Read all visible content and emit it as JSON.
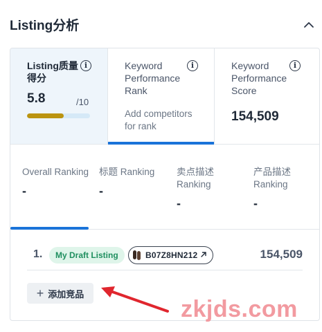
{
  "header": {
    "title": "Listing分析",
    "collapse_icon": "chevron-up-icon"
  },
  "metrics": {
    "score": {
      "label": "Listing质量得分",
      "value": "5.8",
      "max": "/10",
      "fraction": 0.58,
      "bar_color": "#bb9410"
    },
    "keyword_rank": {
      "label": "Keyword Performance Rank",
      "action": "Add competitors for rank"
    },
    "keyword_score": {
      "label": "Keyword Performance Score",
      "value": "154,509"
    }
  },
  "rankings": [
    {
      "label": "Overall Ranking",
      "value": "-"
    },
    {
      "label": "标题 Ranking",
      "value": "-"
    },
    {
      "label": "卖点描述 Ranking",
      "value": "-"
    },
    {
      "label": "产品描述 Ranking",
      "value": "-"
    }
  ],
  "listing": {
    "index": "1.",
    "badge": "My Draft Listing",
    "asin": "B07Z8HN212",
    "asin_icon": "external-link-icon",
    "score": "154,509"
  },
  "add_button": {
    "label": "添加竞品",
    "icon": "plus-icon"
  },
  "watermark": "zkjds.com",
  "colors": {
    "accent": "#1a73d9",
    "badge_bg": "#dff5ea",
    "badge_text": "#1f8f5f",
    "arrow": "#e0262e",
    "watermark": "#f29aa0"
  }
}
